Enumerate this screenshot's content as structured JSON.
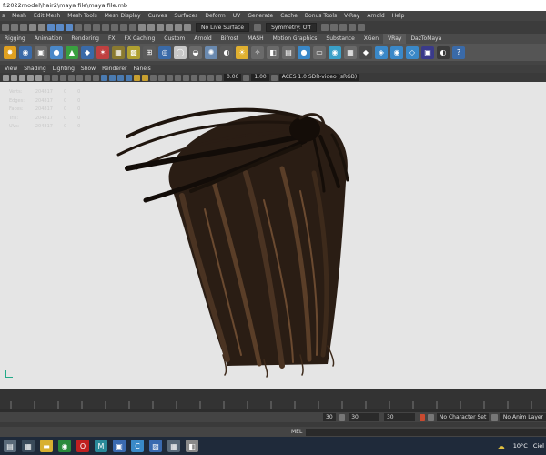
{
  "window": {
    "title": "f:2022model\\hair2\\maya file\\maya file.mb"
  },
  "menu": [
    "s",
    "Mesh",
    "Edit Mesh",
    "Mesh Tools",
    "Mesh Display",
    "Curves",
    "Surfaces",
    "Deform",
    "UV",
    "Generate",
    "Cache",
    "Bonus Tools",
    "V-Ray",
    "Arnold",
    "Help"
  ],
  "status": {
    "live_surface": "No Live Surface",
    "symmetry": "Symmetry: Off"
  },
  "shelf_tabs": [
    "Rigging",
    "Animation",
    "Rendering",
    "FX",
    "FX Caching",
    "Custom",
    "Arnold",
    "Bifrost",
    "MASH",
    "Motion Graphics",
    "Substance",
    "XGen",
    "VRay",
    "DazToMaya"
  ],
  "shelf_active_tab": "VRay",
  "viewport": {
    "menu": [
      "View",
      "Shading",
      "Lighting",
      "Show",
      "Renderer",
      "Panels"
    ],
    "exposure": "0.00",
    "gamma": "1.00",
    "colorspace": "ACES 1.0 SDR-video (sRGB)",
    "hud": [
      {
        "label": "Verts:",
        "v1": "204817",
        "v2": "0",
        "v3": "0"
      },
      {
        "label": "Edges:",
        "v1": "204817",
        "v2": "0",
        "v3": "0"
      },
      {
        "label": "Faces:",
        "v1": "204817",
        "v2": "0",
        "v3": "0"
      },
      {
        "label": "Tris:",
        "v1": "204817",
        "v2": "0",
        "v3": "0"
      },
      {
        "label": "UVs:",
        "v1": "204817",
        "v2": "0",
        "v3": "0"
      }
    ]
  },
  "timeline": {
    "current_frame": "30",
    "range_start": "30",
    "range_end": "30",
    "character_set": "No Character Set",
    "anim_layer": "No Anim Layer"
  },
  "mel_label": "MEL",
  "taskbar": {
    "temperature": "10°C",
    "weather": "Ciel"
  }
}
